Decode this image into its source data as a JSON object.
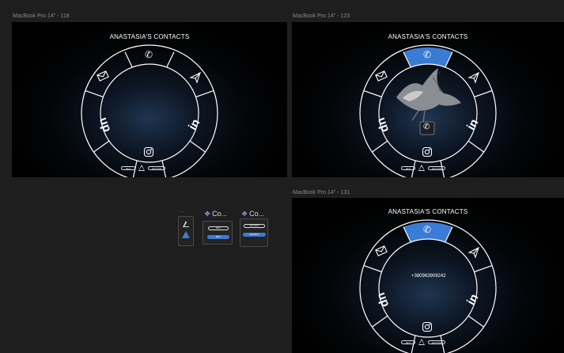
{
  "frames": [
    {
      "label": "MacBook Pro 14\" - 118",
      "title": "ANASTASIA'S CONTACTS",
      "next": "NEXT",
      "sections": "SECTIONS"
    },
    {
      "label": "MacBook Pro 14\" - 123",
      "title": "ANASTASIA'S CONTACTS",
      "next": "NEXT",
      "sections": "SECTIONS"
    },
    {
      "label": "MacBook Pro 14\" - 131",
      "title": "ANASTASIA'S CONTACTS",
      "next": "NEXT",
      "sections": "SECTIONS",
      "phone": "+380963909242"
    }
  ],
  "components": {
    "variants_dots": "...",
    "component_a": {
      "title": "Co...",
      "btn1": "NEXT",
      "btn2": "NEXT"
    },
    "component_b": {
      "title": "Co...",
      "btn1": "SECTIONS",
      "btn2": "SECTIONS"
    }
  },
  "colors": {
    "canvas": "#1e1e1e",
    "accent": "#3a7bd5",
    "ring": "#ffffff",
    "component_purple": "#b184e8"
  },
  "icons": [
    "phone-icon",
    "paper-plane-icon",
    "linkedin-icon",
    "instagram-icon",
    "upwork-icon",
    "mail-icon",
    "bird-image",
    "triangle-icon"
  ]
}
